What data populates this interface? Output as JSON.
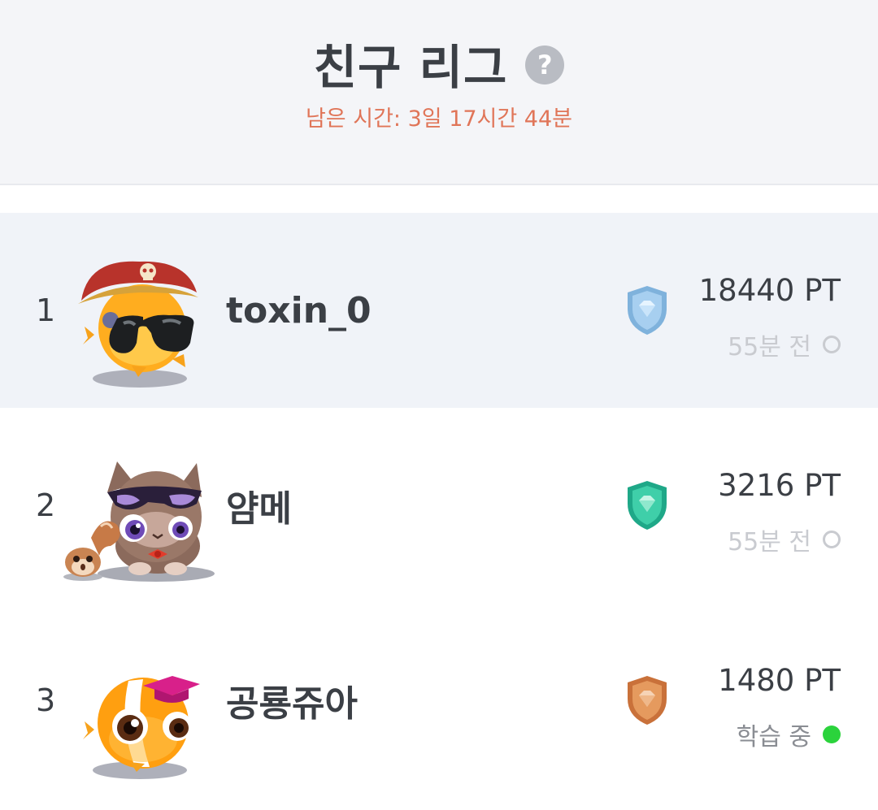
{
  "header": {
    "title": "친구 리그",
    "help_icon": "question-circle-icon",
    "time_remaining": "남은 시간: 3일 17시간 44분"
  },
  "colors": {
    "accent_timer": "#e07558",
    "online_dot": "#2bd33c",
    "highlight_row": "#f0f3f8"
  },
  "league": {
    "entries": [
      {
        "rank": "1",
        "username": "toxin_0",
        "avatar": "pirate-fish-with-sunglasses-avatar",
        "tier_badge": "diamond-shield-icon",
        "points": "18440 PT",
        "status_text": "55분 전",
        "status_icon": "offline-circle-icon"
      },
      {
        "rank": "2",
        "username": "얌메",
        "avatar": "cat-with-sunglasses-and-squirrel-avatar",
        "tier_badge": "emerald-shield-icon",
        "points": "3216 PT",
        "status_text": "55분 전",
        "status_icon": "offline-circle-icon"
      },
      {
        "rank": "3",
        "username": "공룡쥬아",
        "avatar": "fish-with-graduation-cap-avatar",
        "tier_badge": "bronze-shield-icon",
        "points": "1480 PT",
        "status_text": "학습 중",
        "status_icon": "online-dot-icon"
      }
    ]
  }
}
